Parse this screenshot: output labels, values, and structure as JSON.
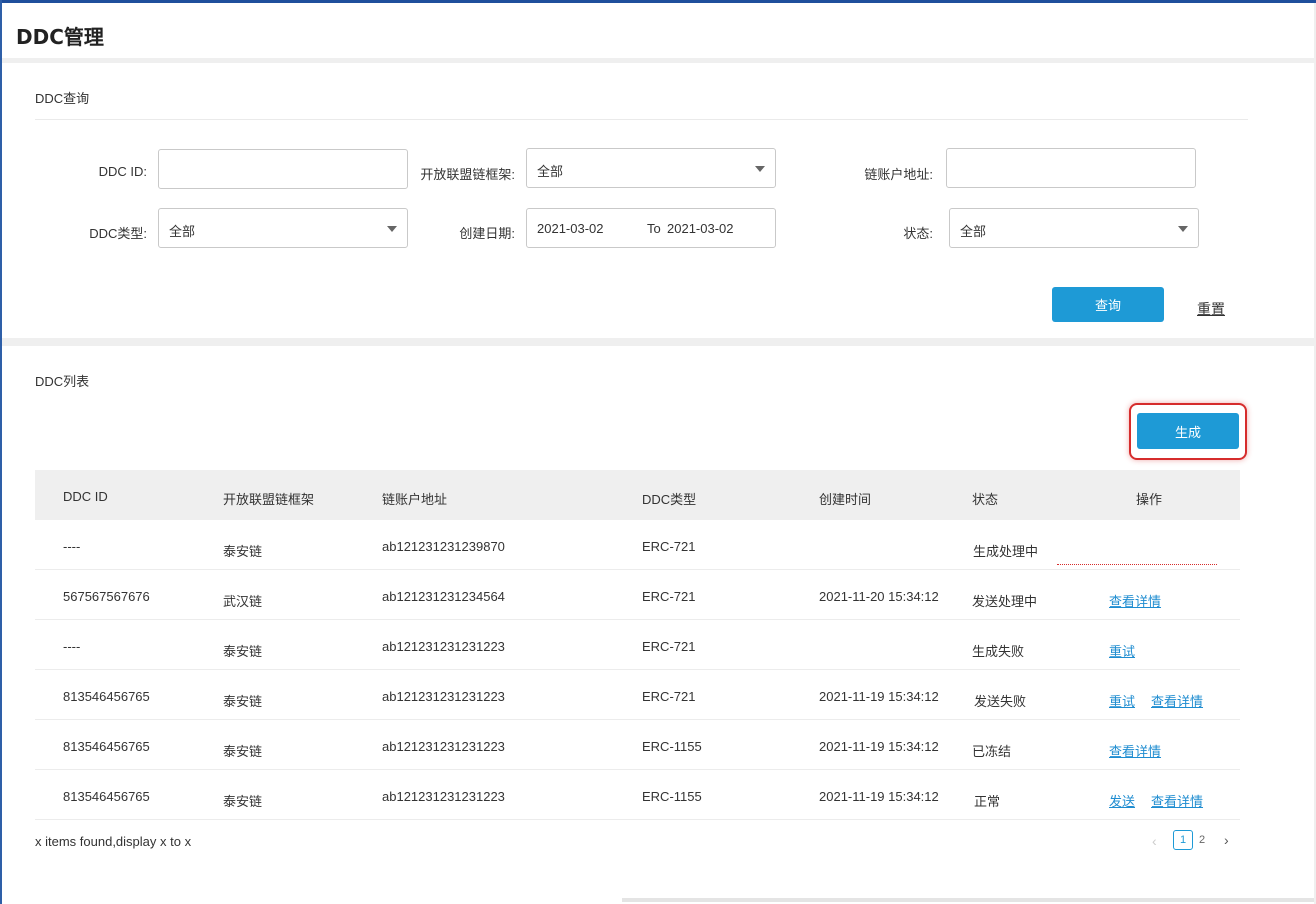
{
  "page": {
    "title": "DDC管理"
  },
  "query": {
    "title": "DDC查询",
    "ddc_id": {
      "label": "DDC ID:",
      "value": ""
    },
    "framework": {
      "label": "开放联盟链框架:",
      "value": "全部"
    },
    "address": {
      "label": "链账户地址:",
      "value": ""
    },
    "ddc_type": {
      "label": "DDC类型:",
      "value": "全部"
    },
    "date": {
      "label": "创建日期:",
      "from": "2021-03-02",
      "to_label": "To",
      "to": "2021-03-02"
    },
    "status": {
      "label": "状态:",
      "value": "全部"
    },
    "search_label": "查询",
    "reset_label": "重置"
  },
  "list": {
    "title": "DDC列表",
    "generate_label": "生成",
    "columns": [
      "DDC ID",
      "开放联盟链框架",
      "链账户地址",
      "DDC类型",
      "创建时间",
      "状态",
      "操作"
    ],
    "rows": [
      {
        "id": "----",
        "framework": "泰安链",
        "address": "ab121231231239870",
        "type": "ERC-721",
        "time": "",
        "status": "生成处理中",
        "actions": []
      },
      {
        "id": "567567567676",
        "framework": "武汉链",
        "address": "ab121231231234564",
        "type": "ERC-721",
        "time": "2021-11-20 15:34:12",
        "status": "发送处理中",
        "actions": [
          "查看详情"
        ]
      },
      {
        "id": "----",
        "framework": "泰安链",
        "address": "ab121231231231223",
        "type": "ERC-721",
        "time": "",
        "status": "生成失败",
        "actions": [
          "重试"
        ]
      },
      {
        "id": "813546456765",
        "framework": "泰安链",
        "address": "ab121231231231223",
        "type": "ERC-721",
        "time": "2021-11-19 15:34:12",
        "status": "发送失败",
        "actions": [
          "重试",
          "查看详情"
        ]
      },
      {
        "id": "813546456765",
        "framework": "泰安链",
        "address": "ab121231231231223",
        "type": "ERC-1155",
        "time": "2021-11-19 15:34:12",
        "status": "已冻结",
        "actions": [
          "查看详情"
        ]
      },
      {
        "id": "813546456765",
        "framework": "泰安链",
        "address": "ab121231231231223",
        "type": "ERC-1155",
        "time": "2021-11-19 15:34:12",
        "status": "正常",
        "actions": [
          "发送",
          "查看详情"
        ]
      }
    ],
    "footer_text": "x items found,display x to x",
    "pagination": {
      "prev_icon": "chevron-left-icon",
      "pages": [
        "1",
        "2"
      ],
      "current": "1",
      "next_icon": "chevron-right-icon"
    }
  },
  "colors": {
    "primary": "#1e9ad6",
    "link": "#1e8cd0",
    "highlight": "#d62c2c",
    "header_bar": "#1f4f9c"
  }
}
